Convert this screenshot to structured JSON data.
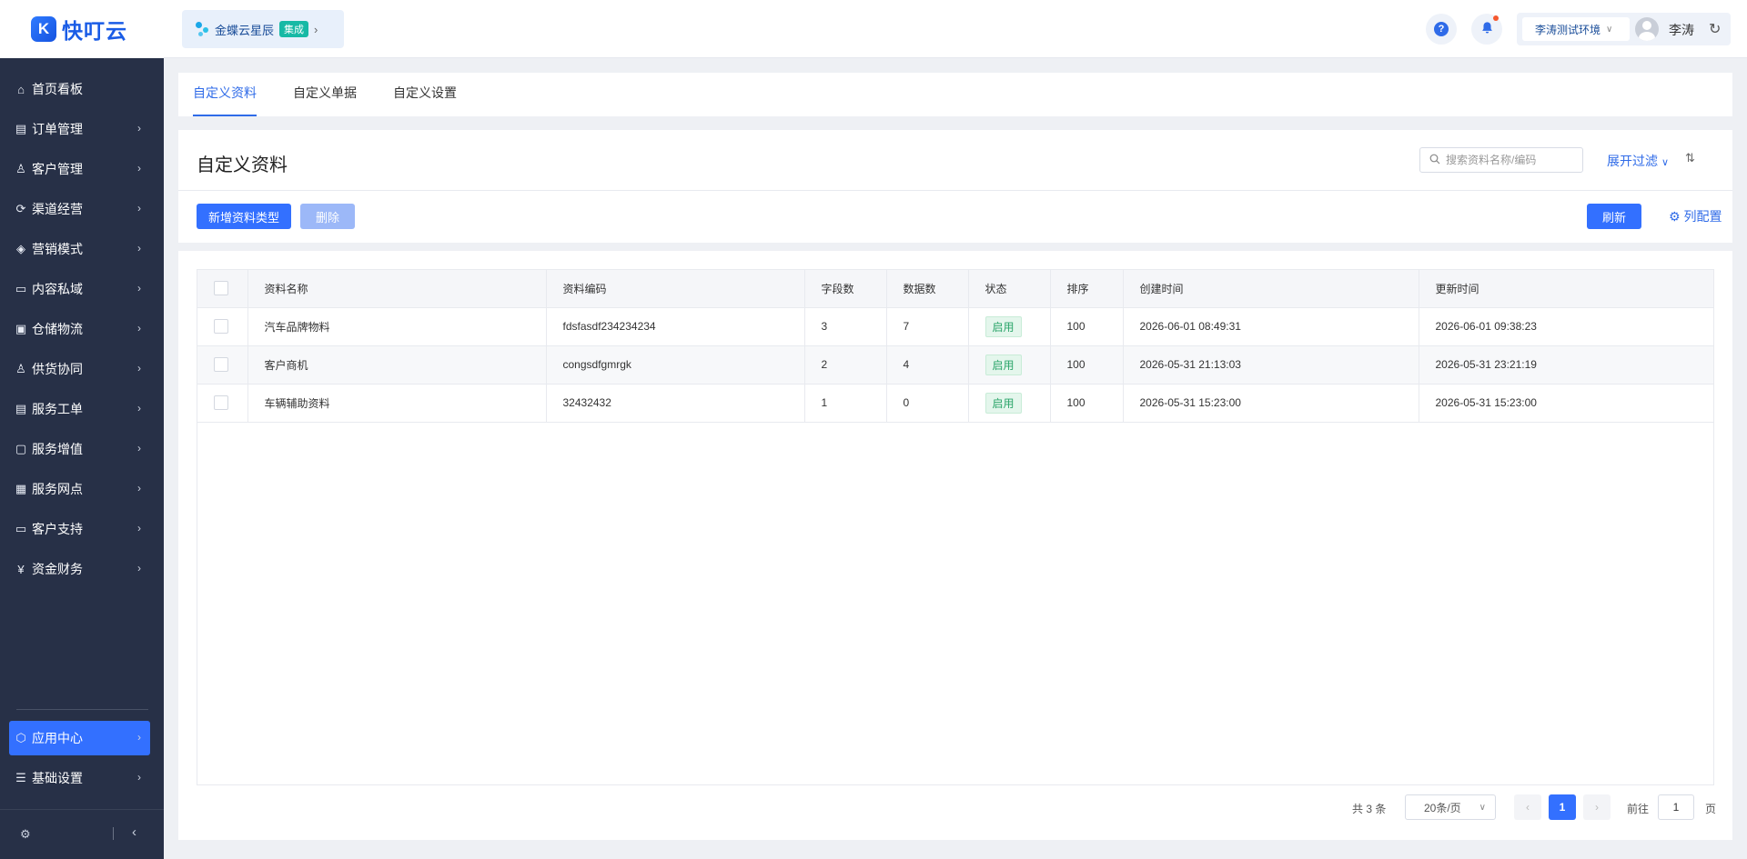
{
  "brand": {
    "logo_glyph": "K",
    "name": "快叮云",
    "color": "#1a5ce6"
  },
  "integration": {
    "name": "金蝶云星辰",
    "tag": "集成"
  },
  "header": {
    "help_icon": "question-circle-icon",
    "bell_icon": "bell-icon",
    "env_name": "李涛测试环境",
    "user_name": "李涛"
  },
  "sidebar": {
    "items": [
      {
        "label": "首页看板",
        "icon": "home-icon"
      },
      {
        "label": "订单管理",
        "icon": "clipboard-icon"
      },
      {
        "label": "客户管理",
        "icon": "user-icon"
      },
      {
        "label": "渠道经营",
        "icon": "channel-icon"
      },
      {
        "label": "营销模式",
        "icon": "tag-icon"
      },
      {
        "label": "内容私域",
        "icon": "image-icon"
      },
      {
        "label": "仓储物流",
        "icon": "warehouse-icon"
      },
      {
        "label": "供货协同",
        "icon": "supply-icon"
      },
      {
        "label": "服务工单",
        "icon": "ticket-icon"
      },
      {
        "label": "服务增值",
        "icon": "bag-icon"
      },
      {
        "label": "服务网点",
        "icon": "store-icon"
      },
      {
        "label": "客户支持",
        "icon": "support-icon"
      },
      {
        "label": "资金财务",
        "icon": "yen-icon"
      },
      {
        "label": "应用中心",
        "icon": "cube-icon"
      },
      {
        "label": "基础设置",
        "icon": "settings-list-icon"
      }
    ]
  },
  "tabs": [
    {
      "label": "自定义资料"
    },
    {
      "label": "自定义单据"
    },
    {
      "label": "自定义设置"
    }
  ],
  "page": {
    "title": "自定义资料",
    "search_placeholder": "搜索资料名称/编码",
    "filter_label": "展开过滤",
    "add_button": "新增资料类型",
    "delete_button": "删除",
    "refresh_button": "刷新",
    "column_config": "列配置"
  },
  "table": {
    "columns": [
      "资料名称",
      "资料编码",
      "字段数",
      "数据数",
      "状态",
      "排序",
      "创建时间",
      "更新时间"
    ],
    "rows": [
      [
        "汽车品牌物料",
        "fdsfasdf234234234",
        "3",
        "7",
        "启用",
        "100",
        "2026-06-01 08:49:31",
        "2026-06-01 09:38:23"
      ],
      [
        "客户商机",
        "congsdfgmrgk",
        "2",
        "4",
        "启用",
        "100",
        "2026-05-31 21:13:03",
        "2026-05-31 23:21:19"
      ],
      [
        "车辆辅助资料",
        "32432432",
        "1",
        "0",
        "启用",
        "100",
        "2026-05-31 15:23:00",
        "2026-05-31 15:23:00"
      ]
    ]
  },
  "pagination": {
    "total": "共 3 条",
    "page_size": "20条/页",
    "current": "1",
    "goto_label": "前往",
    "goto_value": "1",
    "unit": "页"
  },
  "colors": {
    "primary": "#3370ff",
    "sidebar_bg": "#273047",
    "status_green": "#2ba56a"
  }
}
